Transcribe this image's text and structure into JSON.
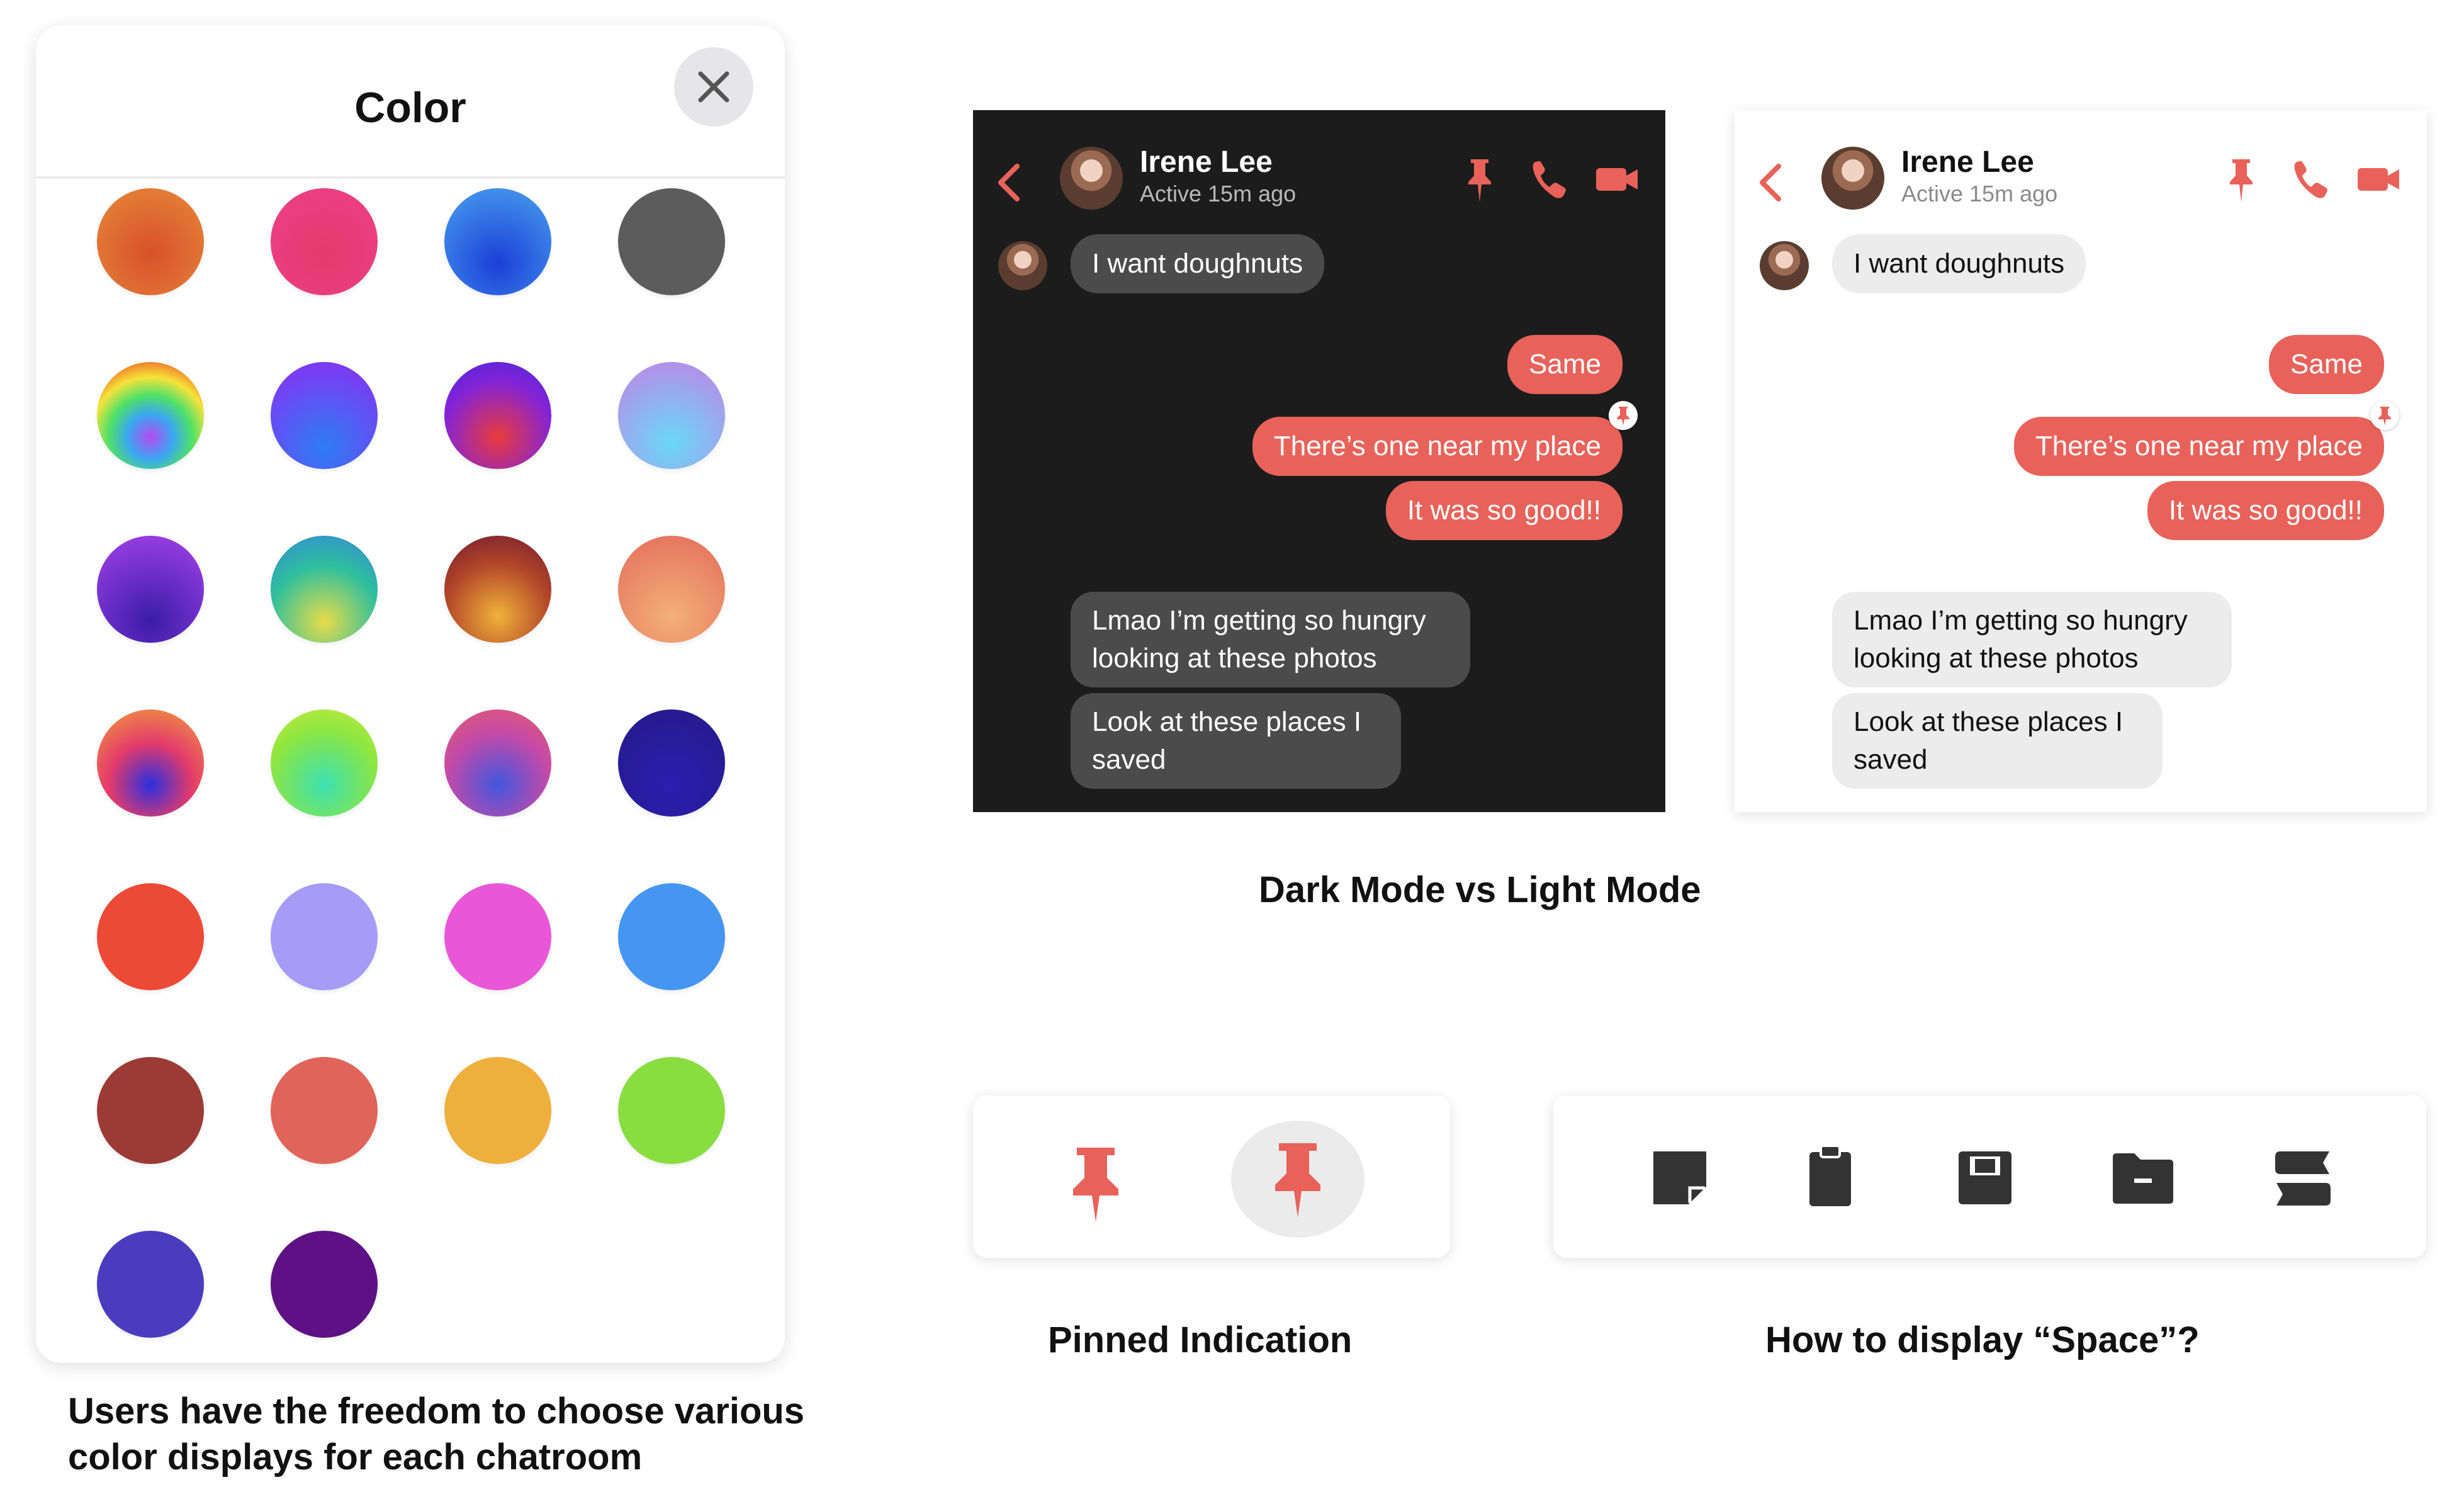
{
  "color_picker": {
    "title": "Color",
    "close_icon": "close-icon",
    "swatches": [
      {
        "name": "orange",
        "gradient": "radial-gradient(circle at 50% 60%, #d9502b, #e58a3a)"
      },
      {
        "name": "pink",
        "gradient": "radial-gradient(circle at 50% 60%, #e23b6c, #ef3f8b)"
      },
      {
        "name": "blue",
        "gradient": "radial-gradient(circle at 50% 70%, #1b3fd8, #4aa2ef)"
      },
      {
        "name": "gray",
        "gradient": "radial-gradient(circle, #5c5c5c, #5c5c5c)"
      },
      {
        "name": "rainbow",
        "gradient": "radial-gradient(circle at 50% 70%, #b24bf3 0%, #3aa8f0 25%, #4ee06a 45%, #f5e33a 65%, #f08a2d 80%, #e5363a 100%)"
      },
      {
        "name": "purple-blue",
        "gradient": "radial-gradient(circle at 50% 80%, #2d7cf6, #7b3cf2 80%)"
      },
      {
        "name": "purple-red",
        "gradient": "radial-gradient(circle at 50% 70%, #ea3a3c, #8324d6 60%, #4b24dd 100%)"
      },
      {
        "name": "lavender-cyan",
        "gradient": "radial-gradient(circle at 50% 75%, #6ad8f8, #b192e8 80%)"
      },
      {
        "name": "violet",
        "gradient": "radial-gradient(circle at 50% 80%, #3a1ca8, #9a3fe2 90%)"
      },
      {
        "name": "teal-yellow",
        "gradient": "radial-gradient(circle at 50% 80%, #e8dc4a, #2fbf9c 55%, #3486dc 100%)"
      },
      {
        "name": "maroon-gold",
        "gradient": "radial-gradient(circle at 50% 75%, #f0b23a, #b2452a 55%, #6e1a2e 100%)"
      },
      {
        "name": "peach",
        "gradient": "radial-gradient(circle at 50% 75%, #f2b07a, #e5725c 90%)"
      },
      {
        "name": "sunset",
        "gradient": "radial-gradient(circle at 50% 70%, #2b2fe0, #e33b6a 45%, #f3a43a 100%)"
      },
      {
        "name": "lime-green",
        "gradient": "radial-gradient(circle at 50% 70%, #3de0b3, #8ee640 60%, #c9ea3f 100%)"
      },
      {
        "name": "magenta-blue",
        "gradient": "radial-gradient(circle at 50% 70%, #4257de, #c34aa8 55%, #e85d6a 100%)"
      },
      {
        "name": "indigo",
        "gradient": "radial-gradient(circle at 50% 70%, #2a1fb1, #251a8a 90%)"
      },
      {
        "name": "red",
        "gradient": "radial-gradient(circle, #ec4a36, #ec4a36)"
      },
      {
        "name": "light-purple",
        "gradient": "radial-gradient(circle, #a69bf6, #a69bf6)"
      },
      {
        "name": "fuchsia",
        "gradient": "radial-gradient(circle, #e957d8, #e957d8)"
      },
      {
        "name": "sky-blue",
        "gradient": "radial-gradient(circle, #4596f1, #4596f1)"
      },
      {
        "name": "brick",
        "gradient": "radial-gradient(circle, #9c3b36, #9c3b36)"
      },
      {
        "name": "salmon",
        "gradient": "radial-gradient(circle, #e06459, #e06459)"
      },
      {
        "name": "amber",
        "gradient": "radial-gradient(circle, #efaf3c, #efaf3c)"
      },
      {
        "name": "green",
        "gradient": "radial-gradient(circle, #8add40, #8add40)"
      },
      {
        "name": "royal-blue",
        "gradient": "radial-gradient(circle, #4a3cbf, #4a3cbf)"
      },
      {
        "name": "deep-purple",
        "gradient": "radial-gradient(circle, #5d1184, #5d1184)"
      }
    ]
  },
  "caption_left": "Users have the freedom to choose various color displays for each chatroom",
  "chat": {
    "contact_name": "Irene Lee",
    "status": "Active 15m ago",
    "accent_color": "#e8625a",
    "header_icons": [
      "back-arrow-icon",
      "pin-icon",
      "phone-icon",
      "video-camera-icon"
    ],
    "messages": [
      {
        "side": "in",
        "text": "I want doughnuts"
      },
      {
        "side": "out",
        "text": "Same"
      },
      {
        "side": "out",
        "text": "There’s one near my place",
        "pinned": true
      },
      {
        "side": "out",
        "text": "It was so good!!"
      },
      {
        "side": "in",
        "text": "Lmao I’m getting so hungry looking at these photos"
      },
      {
        "side": "in",
        "text": "Look at these places I saved"
      }
    ]
  },
  "caption_mode": "Dark Mode vs Light Mode",
  "pinned": {
    "caption": "Pinned Indication",
    "icons": [
      "pin-icon",
      "pin-icon-highlighted"
    ]
  },
  "space": {
    "caption": "How to display “Space”?",
    "icons": [
      "sticky-note-icon",
      "clipboard-icon",
      "floppy-disk-icon",
      "folder-icon",
      "stack-icon"
    ]
  }
}
